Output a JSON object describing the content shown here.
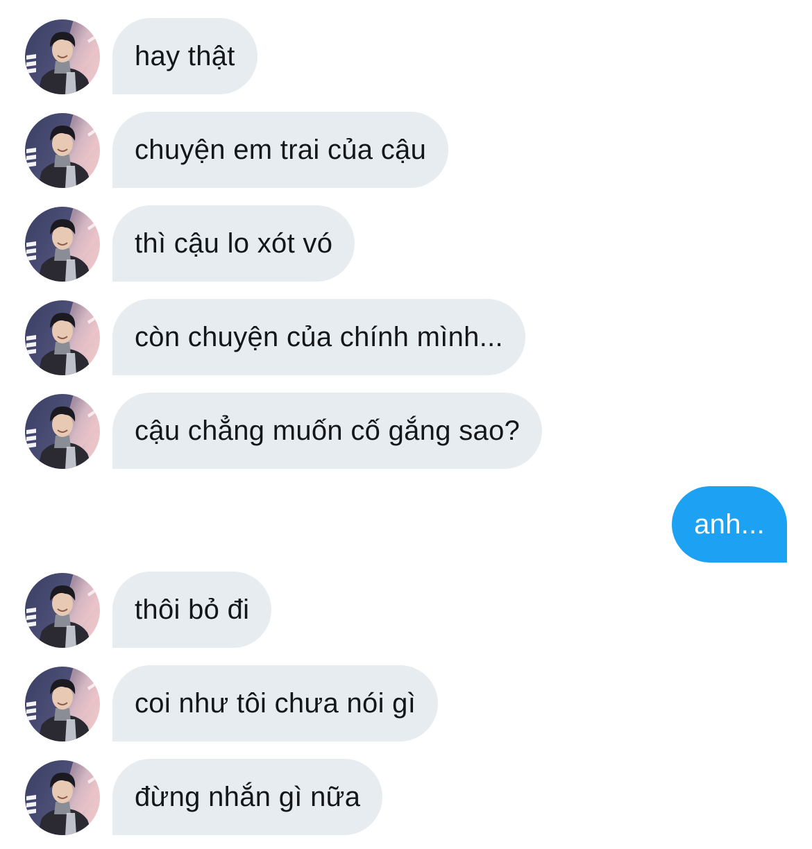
{
  "conversation": {
    "colors": {
      "incoming_bubble": "#e6ecf0",
      "incoming_text": "#14171a",
      "outgoing_bubble": "#1da1f2",
      "outgoing_text": "#ffffff"
    },
    "avatar_icon": "contact-avatar-icon",
    "messages": [
      {
        "sender": "contact",
        "text": "hay thật"
      },
      {
        "sender": "contact",
        "text": "chuyện em trai của cậu"
      },
      {
        "sender": "contact",
        "text": "thì cậu lo xót vó"
      },
      {
        "sender": "contact",
        "text": "còn chuyện của chính mình..."
      },
      {
        "sender": "contact",
        "text": "cậu chẳng muốn cố gắng sao?"
      },
      {
        "sender": "me",
        "text": "anh..."
      },
      {
        "sender": "contact",
        "text": "thôi bỏ đi"
      },
      {
        "sender": "contact",
        "text": "coi như tôi chưa nói gì"
      },
      {
        "sender": "contact",
        "text": "đừng nhắn gì nữa"
      }
    ]
  }
}
